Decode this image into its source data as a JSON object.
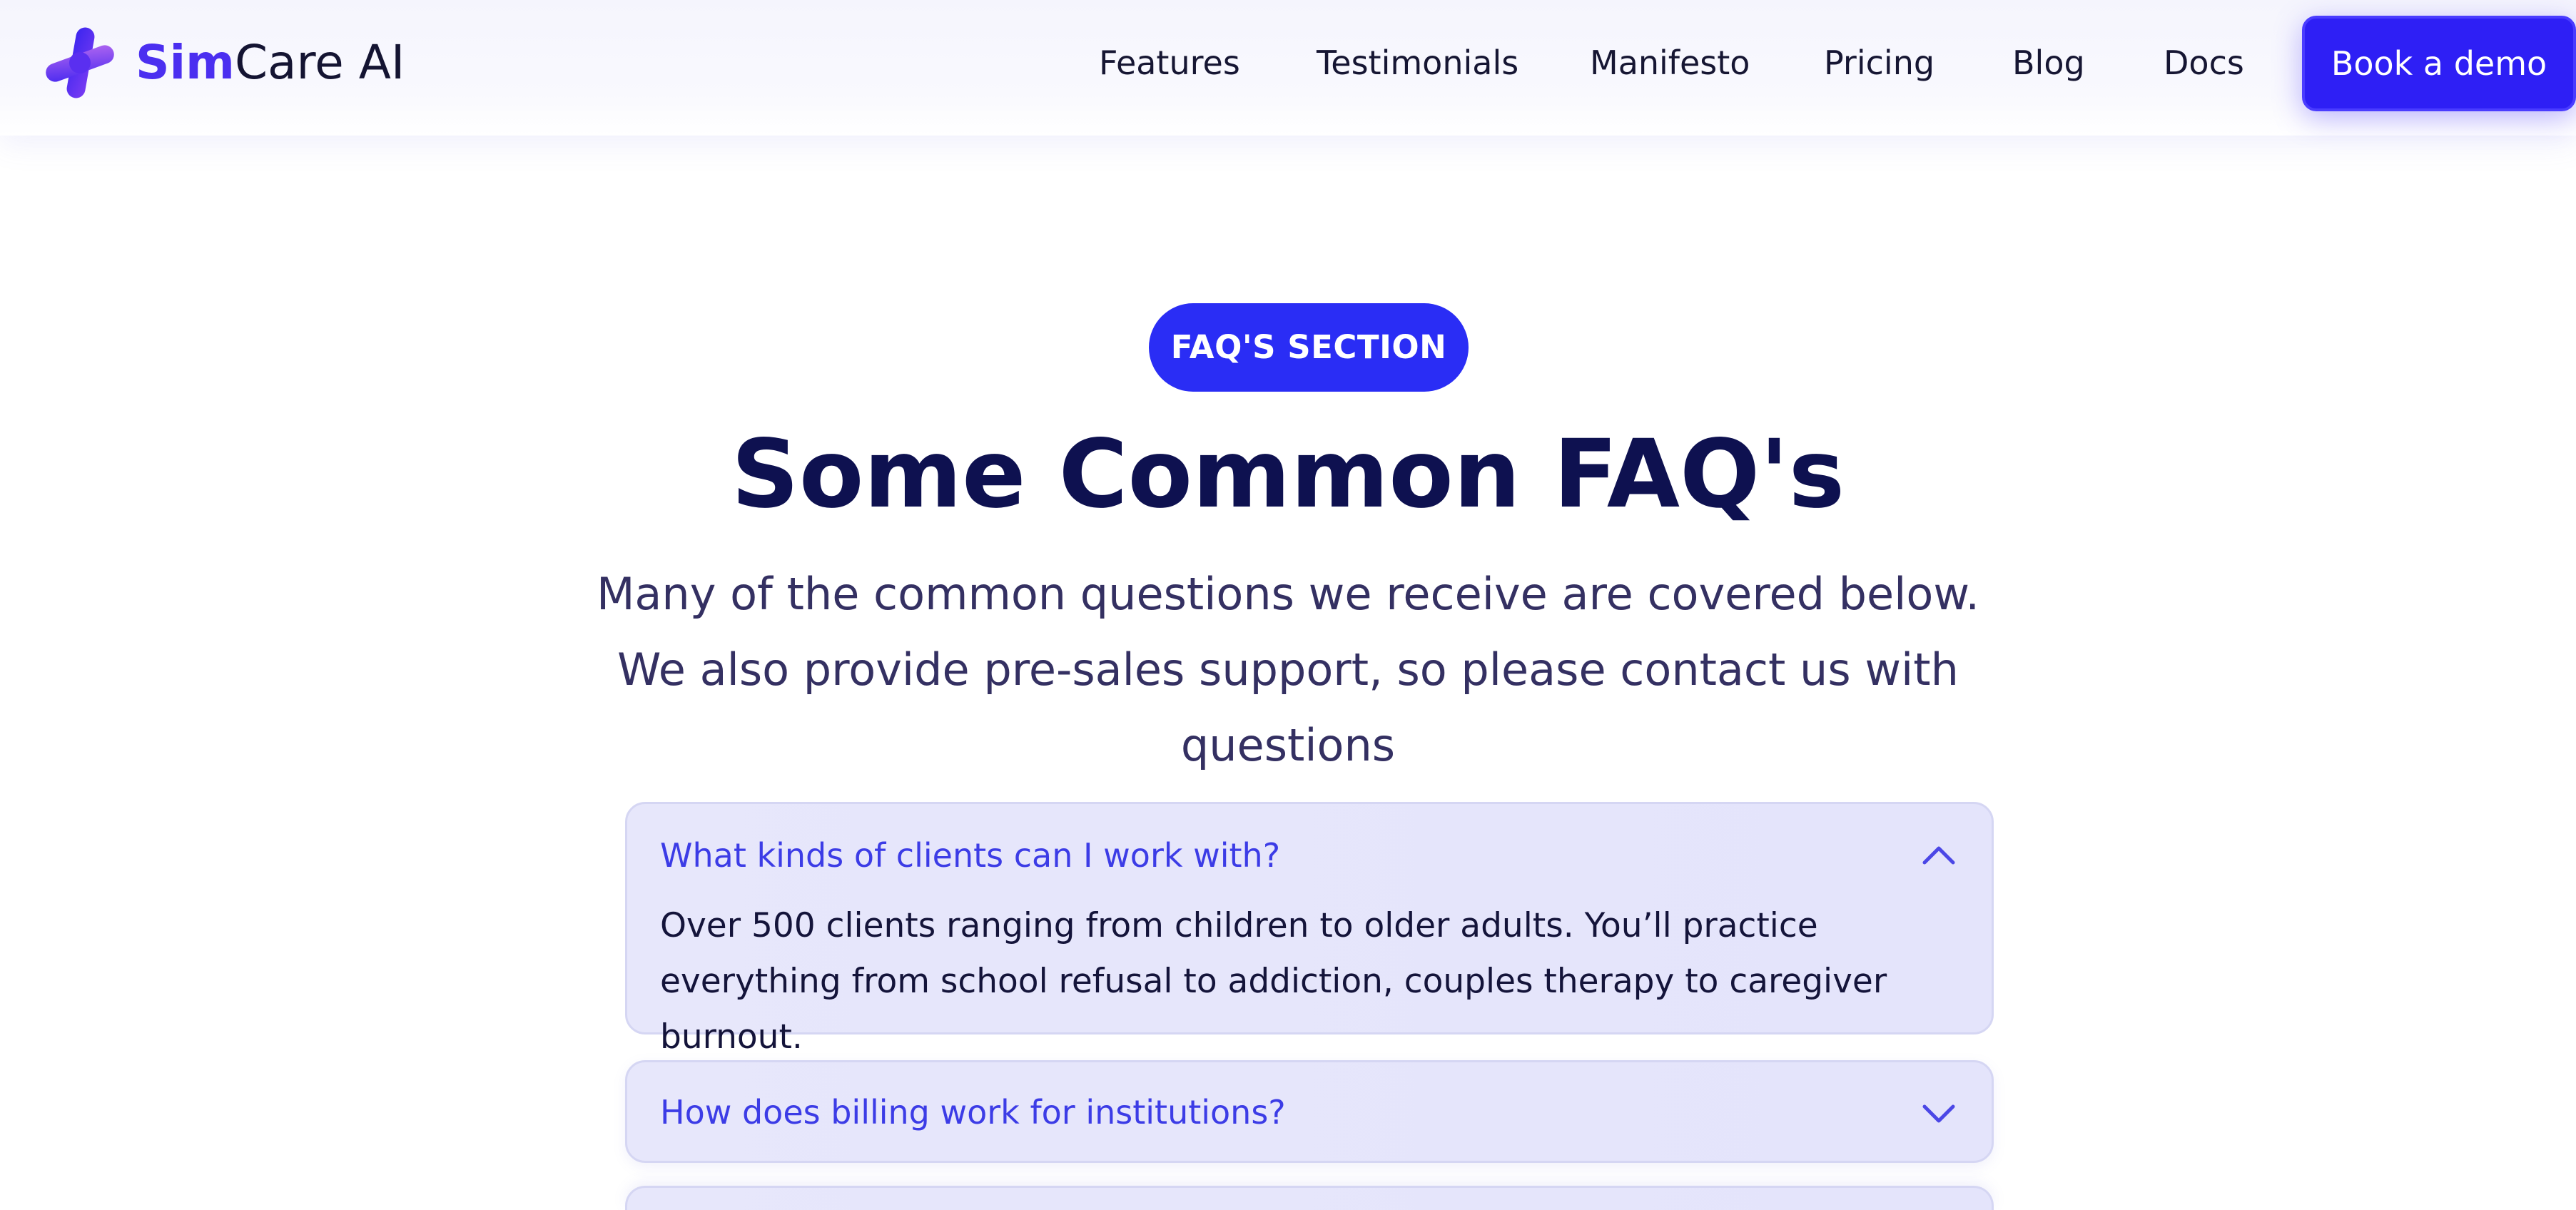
{
  "brand": {
    "name_part1": "Sim",
    "name_part2": "Care AI",
    "colors": {
      "primary": "#2e1ff5",
      "logo_accent": "#4b2ff0",
      "heading": "#0e1150",
      "faq_question": "#3c3ce6"
    }
  },
  "nav": {
    "items": [
      {
        "label": "Features"
      },
      {
        "label": "Testimonials"
      },
      {
        "label": "Manifesto"
      },
      {
        "label": "Pricing"
      },
      {
        "label": "Blog"
      },
      {
        "label": "Docs"
      }
    ],
    "cta_label": "Book a demo"
  },
  "faq": {
    "badge": "FAQ'S SECTION",
    "title": "Some Common FAQ's",
    "subtitle": "Many of the common questions we receive are covered below. We also provide pre-sales support, so please contact us with questions",
    "items": [
      {
        "question": "What kinds of clients can I work with?",
        "answer": "Over 500 clients ranging from children to older adults. You’ll practice everything from school refusal to addiction, couples therapy to caregiver burnout.",
        "expanded": true,
        "icon": "chevron-up-icon"
      },
      {
        "question": "How does billing work for institutions?",
        "answer": "",
        "expanded": false,
        "icon": "chevron-down-icon"
      }
    ]
  }
}
